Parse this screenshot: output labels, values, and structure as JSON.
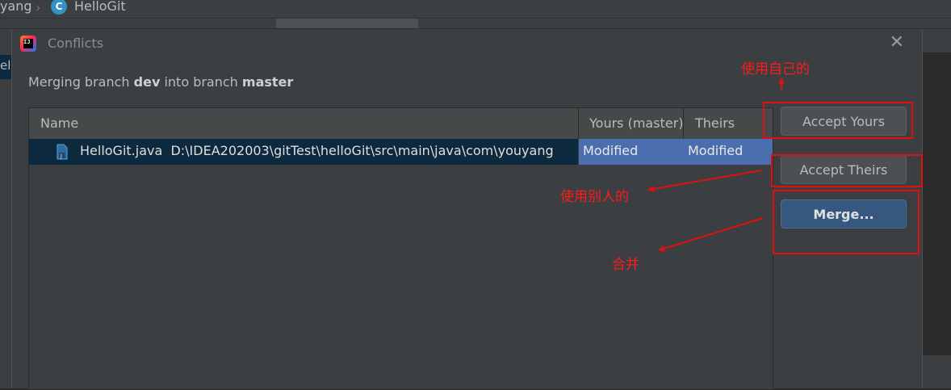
{
  "breadcrumb": {
    "parent": "yang",
    "current": "HelloGit",
    "class_icon": "C"
  },
  "left_strip": {
    "label": "el"
  },
  "dialog": {
    "title": "Conflicts",
    "close_glyph": "✕",
    "merging": {
      "prefix": "Merging branch ",
      "source": "dev",
      "middle": " into branch ",
      "target": "master"
    },
    "table": {
      "headers": {
        "name": "Name",
        "yours": "Yours (master)",
        "theirs": "Theirs (dev)"
      },
      "rows": [
        {
          "file": "HelloGit.java",
          "path": "D:\\IDEA202003\\gitTest\\helloGit\\src\\main\\java\\com\\youyang",
          "yours": "Modified",
          "theirs": "Modified"
        }
      ]
    },
    "buttons": {
      "accept_yours": "Accept Yours",
      "accept_theirs": "Accept Theirs",
      "merge": "Merge..."
    }
  },
  "annotations": {
    "use_mine": "使用自己的",
    "use_others": "使用别人的",
    "merge": "合并"
  },
  "colors": {
    "annotation": "#e01010",
    "selection": "#0d293e",
    "status_cell": "#4b6eaf",
    "merge_button": "#365880"
  }
}
